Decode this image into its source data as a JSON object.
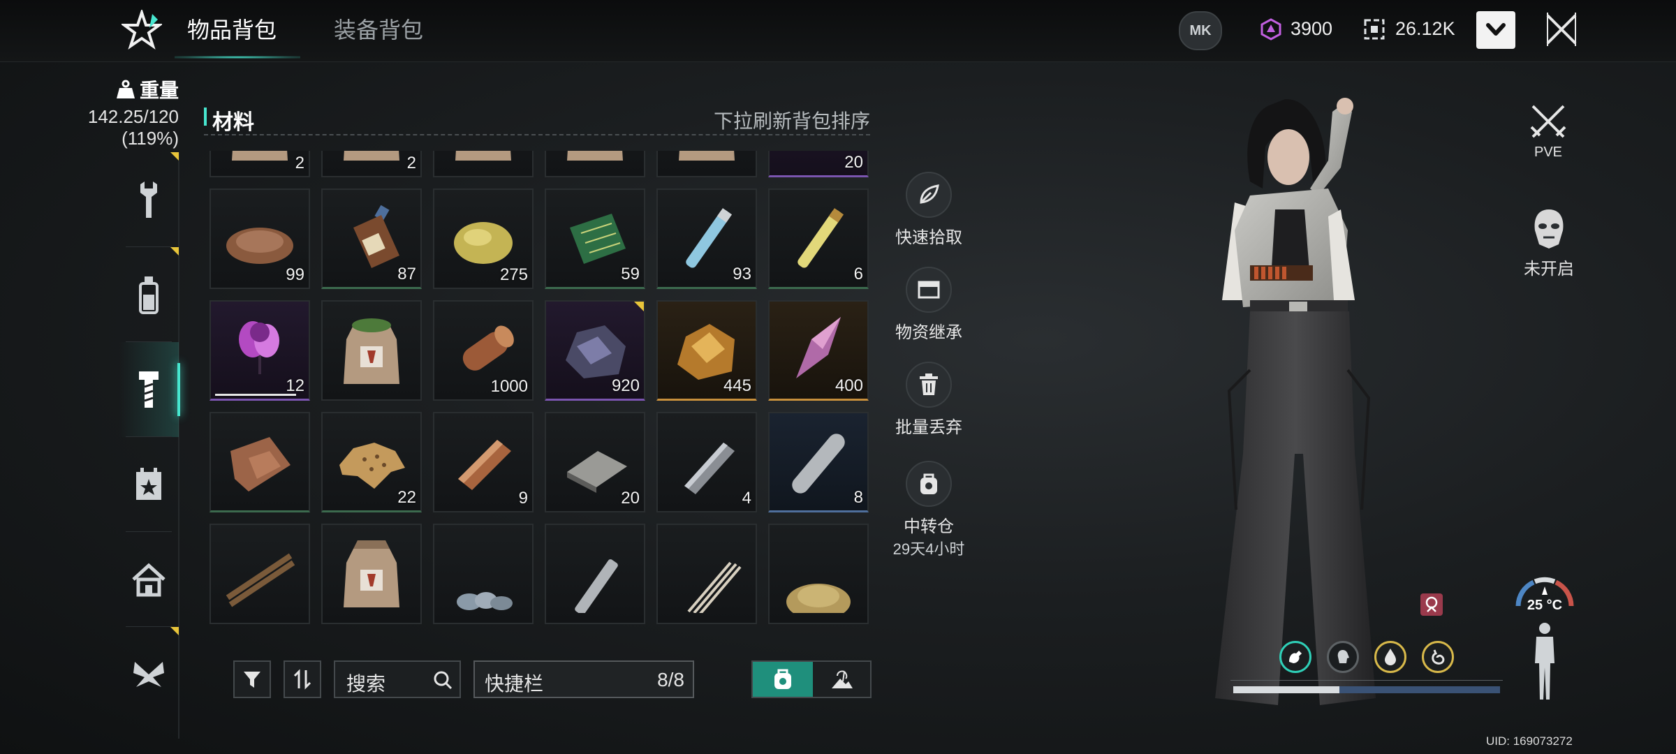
{
  "tabs": {
    "items": "物品背包",
    "equipment": "装备背包"
  },
  "currency": {
    "gems": "3900",
    "credits": "26.12K"
  },
  "mk_button": "MK",
  "weight": {
    "label": "重量",
    "value": "142.25/120",
    "percent": "(119%)"
  },
  "sidebar_categories": [
    "tools",
    "consumables",
    "materials",
    "events",
    "building",
    "faction"
  ],
  "section": {
    "title": "材料",
    "hint": "下拉刷新背包排序"
  },
  "inventory": {
    "rows": [
      [
        {
          "name": "sack",
          "count": "2",
          "q": "none"
        },
        {
          "name": "sack",
          "count": "2",
          "q": "none"
        },
        {
          "name": "sack",
          "count": "",
          "q": "none"
        },
        {
          "name": "sack",
          "count": "",
          "q": "none"
        },
        {
          "name": "sack",
          "count": "",
          "q": "none"
        },
        {
          "name": "purple-orb",
          "count": "20",
          "q": "purple"
        }
      ],
      [
        {
          "name": "ore-pile",
          "count": "99",
          "q": "none"
        },
        {
          "name": "bottle",
          "count": "87",
          "q": "green"
        },
        {
          "name": "sulfur-lump",
          "count": "275",
          "q": "none"
        },
        {
          "name": "circuit-board",
          "count": "59",
          "q": "green"
        },
        {
          "name": "blue-vial",
          "count": "93",
          "q": "green"
        },
        {
          "name": "yellow-vial",
          "count": "6",
          "q": "green"
        }
      ],
      [
        {
          "name": "purple-flower",
          "count": "12",
          "q": "purple"
        },
        {
          "name": "seed-sack",
          "count": "",
          "q": "none"
        },
        {
          "name": "wood-log",
          "count": "1000",
          "q": "none"
        },
        {
          "name": "dark-ore",
          "count": "920",
          "q": "purple"
        },
        {
          "name": "gold-ore",
          "count": "445",
          "q": "gold"
        },
        {
          "name": "crystal-shard",
          "count": "400",
          "q": "gold"
        }
      ],
      [
        {
          "name": "leather",
          "count": "",
          "q": "green"
        },
        {
          "name": "animal-hide",
          "count": "22",
          "q": "green"
        },
        {
          "name": "copper-ingot",
          "count": "9",
          "q": "none"
        },
        {
          "name": "steel-plate",
          "count": "20",
          "q": "none"
        },
        {
          "name": "steel-bar",
          "count": "4",
          "q": "none"
        },
        {
          "name": "metal-rod",
          "count": "8",
          "q": "blue"
        }
      ],
      [
        {
          "name": "wood-bundle",
          "count": "",
          "q": "none"
        },
        {
          "name": "sack",
          "count": "",
          "q": "none"
        },
        {
          "name": "stones",
          "count": "",
          "q": "none"
        },
        {
          "name": "tube",
          "count": "",
          "q": "none"
        },
        {
          "name": "fiber",
          "count": "",
          "q": "none"
        },
        {
          "name": "sand-pile",
          "count": "",
          "q": "none"
        }
      ]
    ]
  },
  "actions": {
    "quick_pickup": "快速拾取",
    "inherit": "物资继承",
    "bulk_discard": "批量丢弃",
    "transit": "中转仓",
    "transit_time": "29天4小时"
  },
  "toolbar": {
    "search": "搜索",
    "hotbar": "快捷栏",
    "hotbar_count": "8/8"
  },
  "right": {
    "pve": "PVE",
    "mask": "未开启",
    "temperature": "25 °C"
  },
  "uid": "UID: 169073272",
  "colors": {
    "accent": "#47e6cf",
    "gold_marker": "#e8c53a",
    "purple_quality": "#7b55b0",
    "gold_quality": "#c8903c"
  }
}
